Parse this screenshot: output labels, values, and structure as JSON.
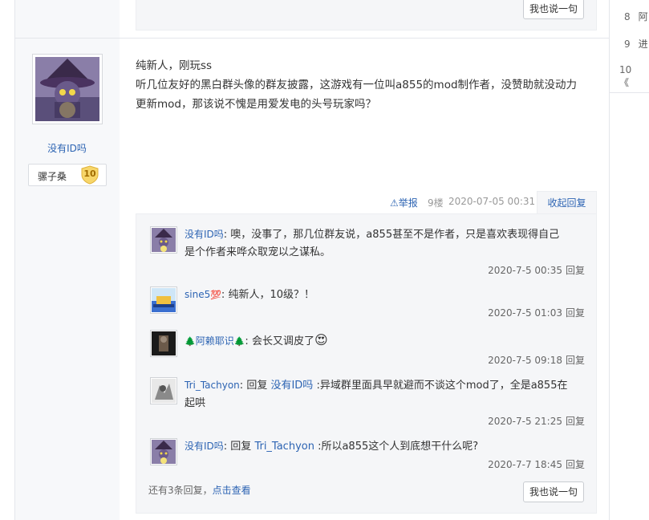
{
  "prev_post": {
    "reply_button": "我也说一句"
  },
  "post": {
    "author": "没有ID吗",
    "badge_name": "骡子桑",
    "badge_level": "10",
    "content_line1": "纯新人，刚玩ss",
    "content_line2": "听几位友好的黑白群头像的群友披露，这游戏有一位叫a855的mod制作者，没赞助就没动力",
    "content_line3": "更新mod，那该说不愧是用爱发电的头号玩家吗？",
    "report": "举报",
    "floor": "9楼",
    "time": "2020-07-05 00:31",
    "toggle_reply": "收起回复"
  },
  "comments": [
    {
      "user": "没有ID吗",
      "sep": ":",
      "line1": " 噢，没事了，那几位群友说，a855甚至不是作者，只是喜欢表现得自己",
      "line2": "是个作者来哗众取宠以之谋私。",
      "time": "2020-7-5 00:35",
      "reply": "回复"
    },
    {
      "user": "sine5",
      "emoji": "💯",
      "sep": ":",
      "line1": " 纯新人，10级？！",
      "time": "2020-7-5 01:03",
      "reply": "回复"
    },
    {
      "user": "阿赖耶识",
      "tree": "🌲",
      "sep": ":",
      "line1": " 会长又调皮了",
      "emoji": "😍",
      "time": "2020-7-5 09:18",
      "reply": "回复"
    },
    {
      "user": "Tri_Tachyon",
      "sep": ":",
      "reply_word": " 回复 ",
      "reply_to": "没有ID吗",
      "line1": " :异域群里面具早就避而不谈这个mod了，全是a855在",
      "line2": "起哄",
      "time": "2020-7-5 21:25",
      "reply": "回复"
    },
    {
      "user": "没有ID吗",
      "sep": ":",
      "reply_word": " 回复 ",
      "reply_to": "Tri_Tachyon",
      "line1": " :所以a855这个人到底想干什么呢?",
      "time": "2020-7-7 18:45",
      "reply": "回复"
    }
  ],
  "more": {
    "text": "还有3条回复，",
    "link": "点击查看"
  },
  "reply_button": "我也说一句",
  "sidebar": [
    {
      "num": "8",
      "text": "阿"
    },
    {
      "num": "9",
      "text": "进"
    },
    {
      "num": "10",
      "text": "《"
    }
  ]
}
